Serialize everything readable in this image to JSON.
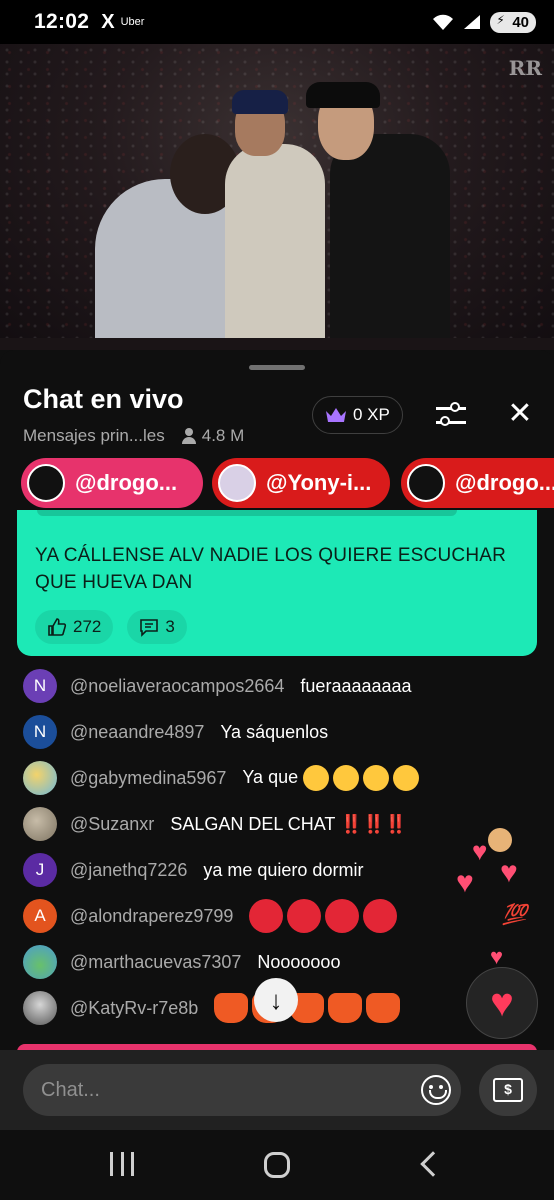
{
  "status_bar": {
    "time": "12:02",
    "app1": "X",
    "app2": "Uber",
    "battery": "40"
  },
  "video": {
    "watermark": "RR"
  },
  "chat": {
    "title": "Chat en vivo",
    "filter_label": "Mensajes prin...les",
    "viewers": "4.8 M",
    "xp": "0 XP"
  },
  "pinned": [
    {
      "handle": "@drogo...",
      "color": "#e7336c"
    },
    {
      "handle": "@Yony-i...",
      "color": "#d91b1b"
    },
    {
      "handle": "@drogo...",
      "color": "#d91b1b"
    }
  ],
  "super_chat": {
    "message": "YA CÁLLENSE ALV NADIE LOS QUIERE ESCUCHAR QUE HUEVA DAN",
    "likes": "272",
    "replies": "3",
    "color": "#1de9b6"
  },
  "messages": [
    {
      "initial": "N",
      "avatar_color": "#6b3fb5",
      "user": "@noeliaveraocampos2664",
      "text": "fueraaaaaaaa"
    },
    {
      "initial": "N",
      "avatar_color": "#1b4e9a",
      "user": "@neaandre4897",
      "text": "Ya sáquenlos"
    },
    {
      "initial": "",
      "avatar_color": "#6fb8d8",
      "user": "@gabymedina5967",
      "text": "Ya que"
    },
    {
      "initial": "",
      "avatar_color": "#a79b86",
      "user": "@Suzanxr",
      "text": "SALGAN DEL CHAT ‼️‼️‼️"
    },
    {
      "initial": "J",
      "avatar_color": "#5b2ba3",
      "user": "@janethq7226",
      "text": "ya me quiero dormir"
    },
    {
      "initial": "A",
      "avatar_color": "#e3541e",
      "user": "@alondraperez9799",
      "text": ""
    },
    {
      "initial": "",
      "avatar_color": "#4b9bd0",
      "user": "@marthacuevas7307",
      "text": "Nooooooo"
    },
    {
      "initial": "",
      "avatar_color": "#8b8b8b",
      "user": "@KatyRv-r7e8b",
      "text": ""
    }
  ],
  "reactions": {
    "hundred": "💯"
  },
  "input": {
    "placeholder": "Chat..."
  },
  "icons": {
    "crown": "crown-icon",
    "filter": "sliders-icon",
    "close": "close-icon",
    "like": "thumbs-up-icon",
    "reply": "comment-icon",
    "emoji": "smiley-icon",
    "super_chat": "money-icon",
    "heart": "heart-icon"
  }
}
